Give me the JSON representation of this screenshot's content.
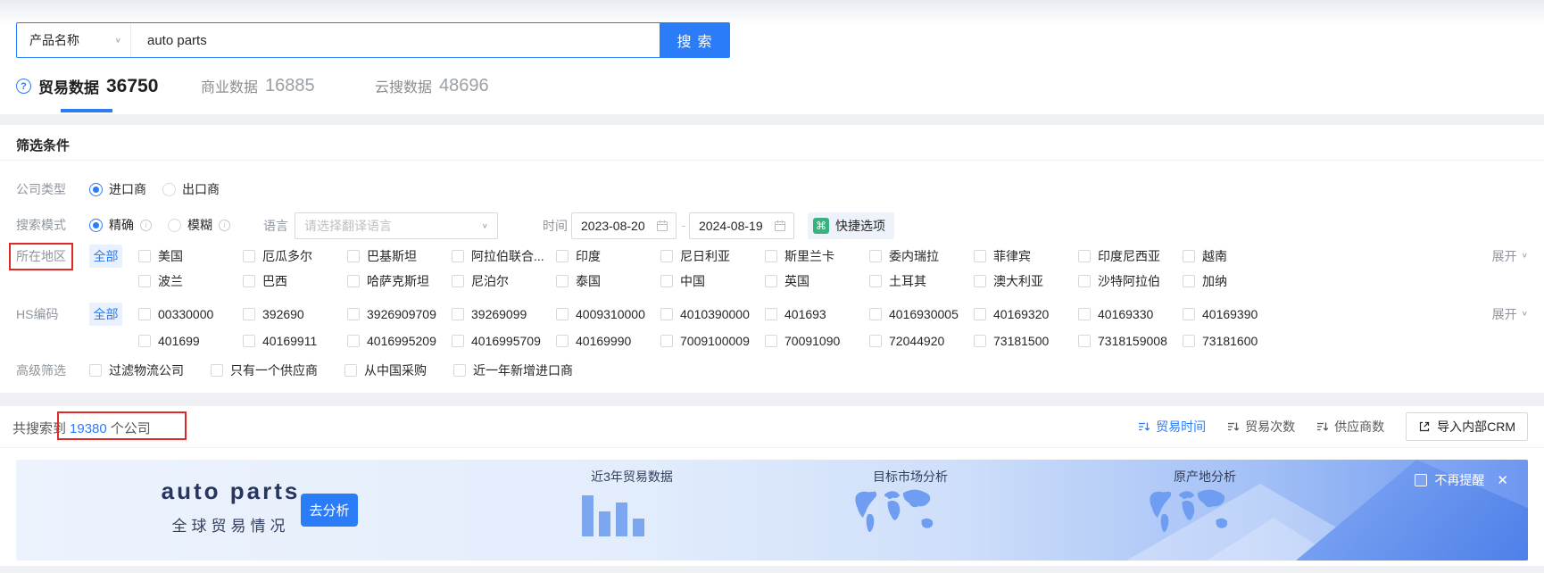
{
  "search": {
    "category": "产品名称",
    "query": "auto parts",
    "button": "搜索"
  },
  "tabs": [
    {
      "label": "贸易数据",
      "count": "36750",
      "active": true
    },
    {
      "label": "商业数据",
      "count": "16885",
      "active": false
    },
    {
      "label": "云搜数据",
      "count": "48696",
      "active": false
    }
  ],
  "filter": {
    "title": "筛选条件",
    "company_type": {
      "label": "公司类型",
      "options": [
        {
          "label": "进口商",
          "selected": true
        },
        {
          "label": "出口商",
          "selected": false
        }
      ]
    },
    "search_mode": {
      "label": "搜索模式",
      "options": [
        {
          "label": "精确",
          "selected": true
        },
        {
          "label": "模糊",
          "selected": false
        }
      ]
    },
    "language": {
      "label": "语言",
      "placeholder": "请选择翻译语言"
    },
    "time": {
      "label": "时间",
      "start": "2023-08-20",
      "separator": "-",
      "end": "2024-08-19"
    },
    "quick_option": "快捷选项",
    "region": {
      "label": "所在地区",
      "all": "全部",
      "expand": "展开",
      "row1": [
        "美国",
        "厄瓜多尔",
        "巴基斯坦",
        "阿拉伯联合...",
        "印度",
        "尼日利亚",
        "斯里兰卡",
        "委内瑞拉",
        "菲律宾",
        "印度尼西亚",
        "越南"
      ],
      "row2": [
        "波兰",
        "巴西",
        "哈萨克斯坦",
        "尼泊尔",
        "泰国",
        "中国",
        "英国",
        "土耳其",
        "澳大利亚",
        "沙特阿拉伯",
        "加纳"
      ]
    },
    "hs_code": {
      "label": "HS编码",
      "all": "全部",
      "expand": "展开",
      "row1": [
        "00330000",
        "392690",
        "3926909709",
        "39269099",
        "4009310000",
        "4010390000",
        "401693",
        "4016930005",
        "40169320",
        "40169330",
        "40169390"
      ],
      "row2": [
        "401699",
        "40169911",
        "4016995209",
        "4016995709",
        "40169990",
        "7009100009",
        "70091090",
        "72044920",
        "73181500",
        "7318159008",
        "73181600"
      ]
    },
    "advanced": {
      "label": "高级筛选",
      "options": [
        "过滤物流公司",
        "只有一个供应商",
        "从中国采购",
        "近一年新增进口商"
      ]
    }
  },
  "results": {
    "summary_prefix": "共搜索到",
    "summary_count": "19380",
    "summary_suffix": "个公司",
    "sorts": [
      "贸易时间",
      "贸易次数",
      "供应商数"
    ],
    "active_sort": "贸易时间",
    "crm_button": "导入内部CRM"
  },
  "banner": {
    "title": "auto parts",
    "subtitle": "全球贸易情况",
    "analyze_button": "去分析",
    "card_chart": "近3年贸易数据",
    "card_market": "目标市场分析",
    "card_origin": "原产地分析",
    "dismiss": "不再提醒",
    "chart_bar_heights": [
      46,
      28,
      38,
      20
    ]
  },
  "icons": {
    "dropdown_chevron": "∨",
    "expand_chevron": "∨",
    "help": "?",
    "info": "i",
    "command": "⌘",
    "close": "✕"
  },
  "colors": {
    "accent_blue": "#2b7cf7",
    "annotation_red": "#e02a2a",
    "quick_icon_green": "#36b37e",
    "banner_bar_blue": "#7da6f1"
  }
}
